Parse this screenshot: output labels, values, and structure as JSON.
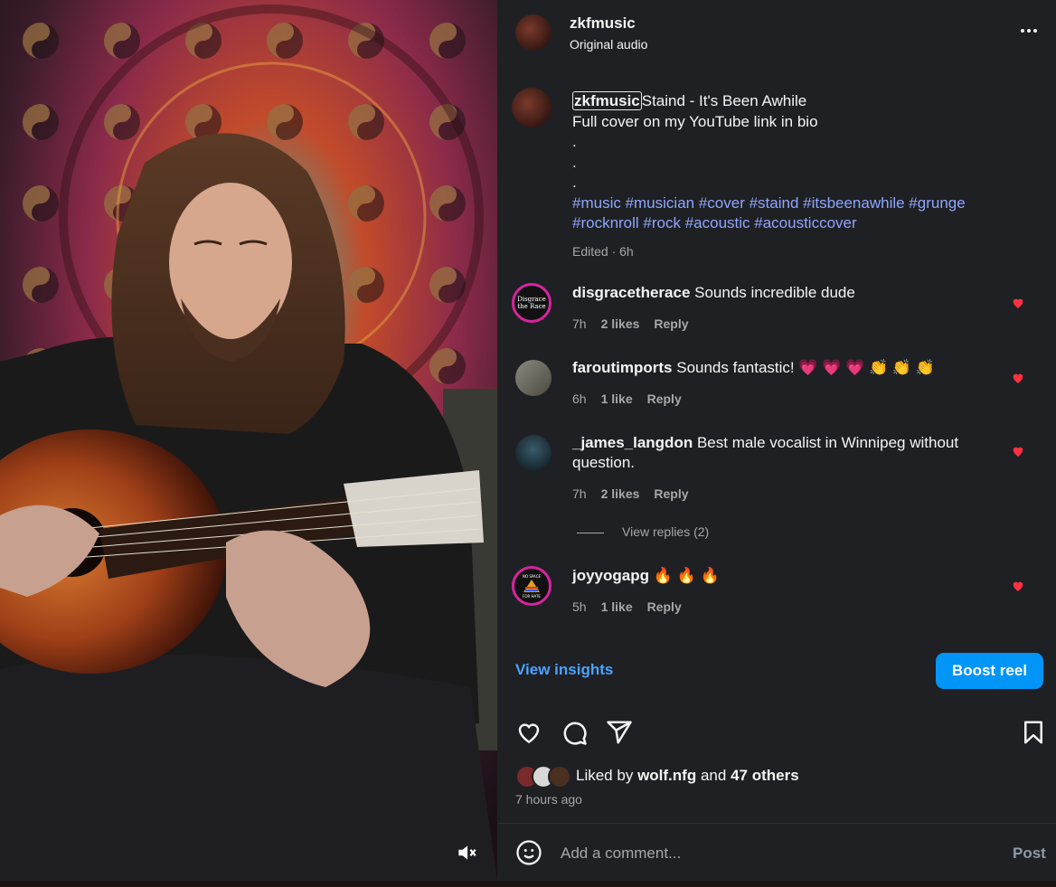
{
  "header": {
    "username": "zkfmusic",
    "audio": "Original audio",
    "more_icon": "more-horizontal-icon"
  },
  "caption": {
    "username": "zkfmusic",
    "line1": "Staind - It's Been Awhile",
    "line2": "Full cover on my YouTube link in bio",
    "dots": [
      ".",
      ".",
      "."
    ],
    "hashtags_line1": "#music #musician #cover #staind #itsbeenawhile #grunge",
    "hashtags_line2": "#rocknroll #rock #acoustic #acousticcover",
    "meta": "Edited · 6h"
  },
  "comments": [
    {
      "username": "disgracetherace",
      "text": "Sounds incredible dude",
      "time": "7h",
      "likes": "2 likes",
      "reply": "Reply",
      "avatar_label": "Disgrace the Race"
    },
    {
      "username": "faroutimports",
      "text": "Sounds fantastic! 💗 💗 💗 👏 👏 👏",
      "time": "6h",
      "likes": "1 like",
      "reply": "Reply"
    },
    {
      "username": "_james_langdon",
      "text": "Best male vocalist in Winnipeg without question.",
      "time": "7h",
      "likes": "2 likes",
      "reply": "Reply"
    },
    {
      "username": "joyyogapg",
      "text": "🔥 🔥 🔥",
      "time": "5h",
      "likes": "1 like",
      "reply": "Reply",
      "avatar_label": "NO SPACE FOR HATE"
    }
  ],
  "view_replies": "View replies (2)",
  "insights": {
    "view_insights": "View insights",
    "boost": "Boost reel"
  },
  "likes": {
    "prefix": "Liked by",
    "user": "wolf.nfg",
    "and": "and",
    "others": "47 others"
  },
  "timestamp": "7 hours ago",
  "comment_box": {
    "placeholder": "Add a comment...",
    "post": "Post"
  },
  "colors": {
    "panel_bg": "#1f2024",
    "accent": "#0095f6",
    "link": "#8fa6ff",
    "heart": "#ff3040"
  }
}
